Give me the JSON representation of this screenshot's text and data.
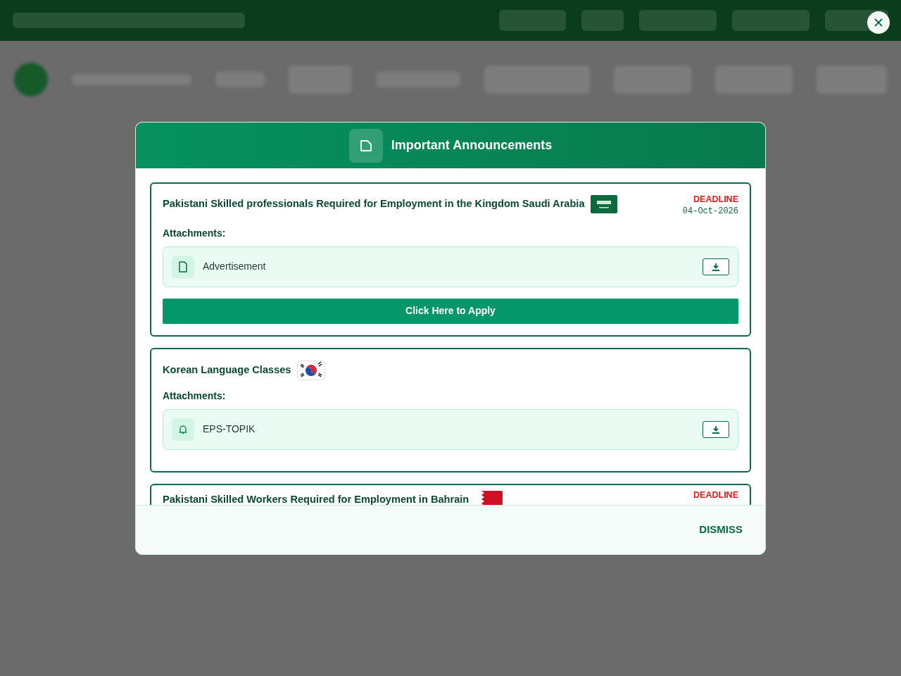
{
  "modal": {
    "title": "Important Announcements",
    "announcements": [
      {
        "title": "Pakistani Skilled professionals Required for Employment in the Kingdom Saudi Arabia",
        "flag": {
          "kind": "saudi"
        },
        "deadline_label": "DEADLINE",
        "deadline": "04-Oct-2026",
        "attachments_label": "Attachments:",
        "attachments": [
          {
            "name": "Advertisement",
            "kind": "document"
          }
        ],
        "apply_button": "Click Here to Apply"
      },
      {
        "title": "Korean Language Classes",
        "flag": {
          "kind": "korea"
        },
        "attachments_label": "Attachments:",
        "attachments": [
          {
            "name": "EPS-TOPIK",
            "kind": "notice"
          }
        ]
      },
      {
        "title": "Pakistani Skilled Workers Required for Employment in Bahrain",
        "flag": {
          "kind": "bahrain"
        },
        "deadline_label": "DEADLINE"
      }
    ],
    "dismiss_button": "DISMISS"
  }
}
